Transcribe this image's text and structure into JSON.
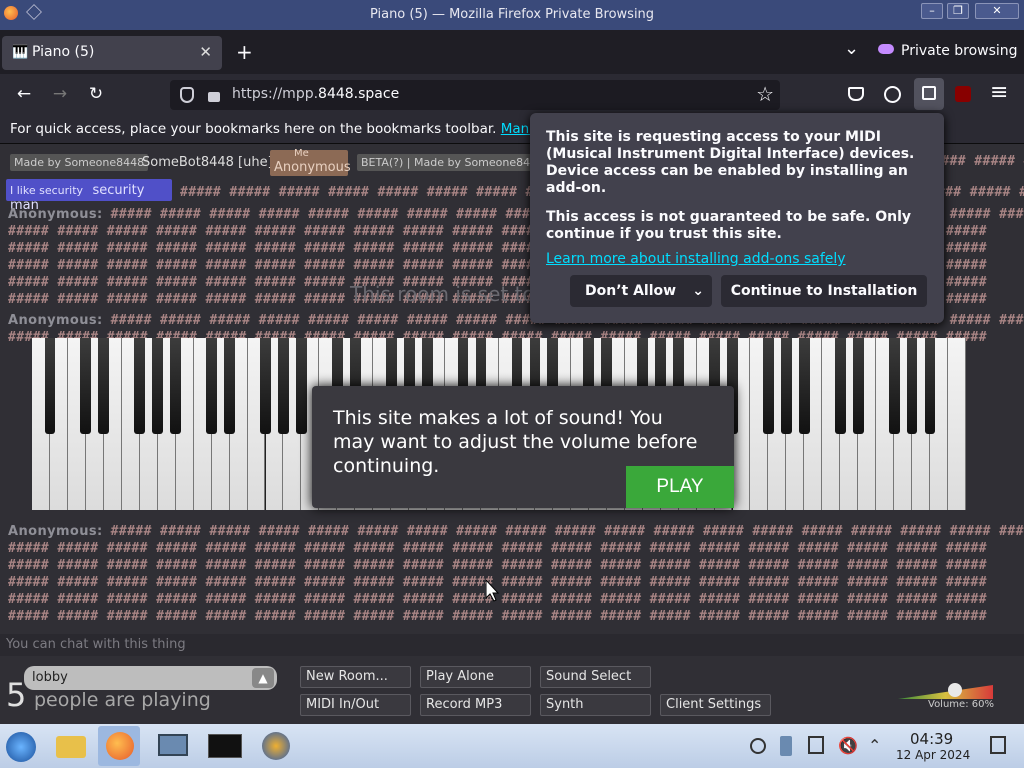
{
  "window": {
    "title": "Piano (5) — Mozilla Firefox Private Browsing",
    "minimize": "–",
    "restore": "❐",
    "close": "✕"
  },
  "tabs": {
    "active_label": "Piano (5)",
    "close": "✕",
    "new_tab": "+",
    "list_all": "⌄",
    "private_label": "Private browsing"
  },
  "nav": {
    "back": "←",
    "forward": "→",
    "reload": "↻",
    "url_prefix": "https://mpp.",
    "url_domain": "8448.space",
    "star": "☆",
    "menu": "≡"
  },
  "bookmarks": {
    "prompt": "For quick access, place your bookmarks here on the bookmarks toolbar.",
    "manage_link": "Mana"
  },
  "users": {
    "tag1": "Made by Someone8448",
    "name1": "SomeBot8448 [uhe]",
    "me_label": "Me",
    "name2": "Anonymous",
    "tag3": "BETA(?) | Made by Someone8448",
    "tag4": "I like security",
    "name4": "security man"
  },
  "chat": {
    "author": "Anonymous:",
    "hashes": "##### ##### ##### ##### ##### ##### ##### ##### ##### ##### ##### ##### ##### ##### ##### ##### ##### ##### ##### #####",
    "room_notice": "This room is set to",
    "placeholder": "You can chat with this thing"
  },
  "sound_modal": {
    "message": "This site makes a lot of sound! You may want to adjust the volume before continuing.",
    "play": "PLAY"
  },
  "midi_popup": {
    "line1": "This site is requesting access to your MIDI (Musical Instrument Digital Interface) devices. Device access can be enabled by installing an add-on.",
    "line2": "This access is not guaranteed to be safe. Only continue if you trust this site.",
    "learn_more": "Learn more about installing add-ons safely",
    "dont_allow": "Don’t Allow",
    "continue": "Continue to Installation"
  },
  "controls": {
    "room_name": "lobby",
    "people_count": "5",
    "people_text": "people are playing",
    "new_room": "New Room...",
    "play_alone": "Play Alone",
    "sound_select": "Sound Select",
    "midi_in_out": "MIDI In/Out",
    "record_mp3": "Record MP3",
    "synth": "Synth",
    "client_settings": "Client Settings",
    "volume_label": "Volume: 60%",
    "volume_level": 0.6
  },
  "taskbar": {
    "time": "04:39",
    "date": "12 Apr 2024"
  }
}
